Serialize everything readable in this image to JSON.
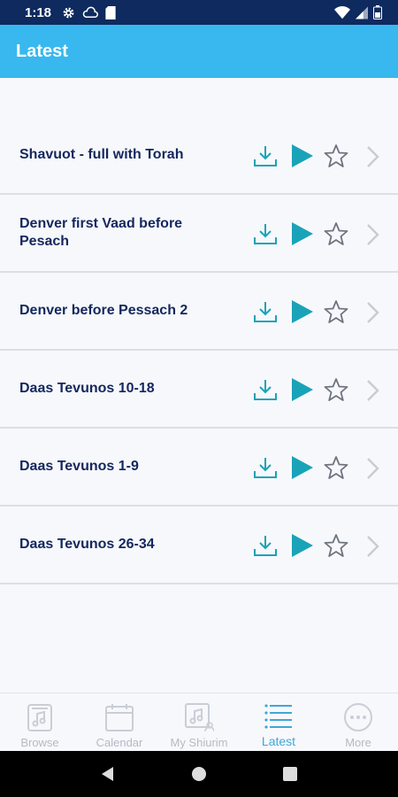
{
  "status_bar": {
    "time": "1:18",
    "left_icons": [
      "gear-icon",
      "cloud-icon",
      "sd-card-icon"
    ],
    "right_icons": [
      "wifi-icon",
      "signal-icon",
      "battery-icon"
    ]
  },
  "app_bar": {
    "title": "Latest"
  },
  "items": [
    {
      "title": "Shavuot - full with Torah"
    },
    {
      "title": "Denver first Vaad before Pesach"
    },
    {
      "title": "Denver before Pessach 2"
    },
    {
      "title": "Daas Tevunos 10-18"
    },
    {
      "title": "Daas Tevunos 1-9"
    },
    {
      "title": "Daas Tevunos 26-34"
    }
  ],
  "tabs": [
    {
      "label": "Browse",
      "icon": "music-folder-icon",
      "active": false
    },
    {
      "label": "Calendar",
      "icon": "calendar-icon",
      "active": false
    },
    {
      "label": "My Shiurim",
      "icon": "my-shiurim-icon",
      "active": false
    },
    {
      "label": "Latest",
      "icon": "list-icon",
      "active": true
    },
    {
      "label": "More",
      "icon": "more-icon",
      "active": false
    }
  ],
  "colors": {
    "status_bar": "#0e2a5e",
    "app_bar": "#38b8ef",
    "item_text": "#14275e",
    "accent": "#1aa3b8",
    "tab_inactive": "#b4bac4",
    "tab_active": "#3fa7d6"
  }
}
